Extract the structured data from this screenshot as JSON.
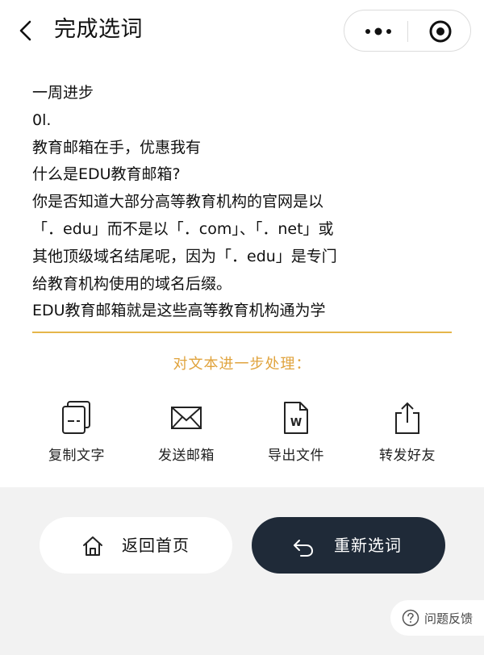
{
  "header": {
    "title": "完成选词"
  },
  "content": {
    "lines": [
      "一周进步",
      "0l.",
      "教育邮箱在手，优惠我有",
      "什么是EDU教育邮箱?",
      "你是否知道大部分高等教育机构的官网是以",
      "「．edu」而不是以「．com」、「．net」或",
      "其他顶级域名结尾呢，因为「．edu」是专门",
      "给教育机构使用的域名后缀。",
      "EDU教育邮箱就是这些高等教育机构通为学"
    ]
  },
  "process": {
    "title": "对文本进一步处理：",
    "accent_color": "#e0a33d"
  },
  "actions": [
    {
      "label": "复制文字",
      "icon": "copy-icon"
    },
    {
      "label": "发送邮箱",
      "icon": "mail-icon"
    },
    {
      "label": "导出文件",
      "icon": "word-file-icon"
    },
    {
      "label": "转发好友",
      "icon": "share-icon"
    }
  ],
  "buttons": {
    "home_label": "返回首页",
    "reselect_label": "重新选词",
    "reselect_color": "#1f2a38"
  },
  "feedback": {
    "label": "问题反馈"
  }
}
